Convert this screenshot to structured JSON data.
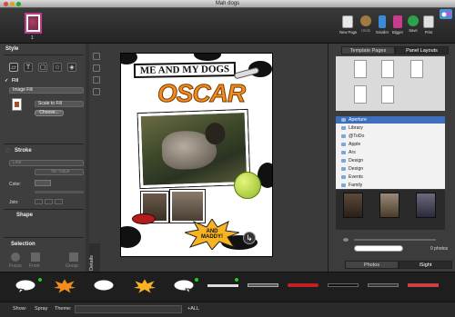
{
  "window": {
    "title": "Mah dogs",
    "traffic_colors": [
      "#e0443e",
      "#dea123",
      "#1aab29"
    ]
  },
  "toolbar": {
    "page_number": "1",
    "buttons": [
      {
        "label": "New Page",
        "color": "#e8e8e8"
      },
      {
        "label": "Undo",
        "color": "#a07a40"
      },
      {
        "label": "Smaller",
        "color": "#3b8ad9"
      },
      {
        "label": "Bigger",
        "color": "#c93b8c"
      },
      {
        "label": "Save",
        "color": "#2aa34a"
      },
      {
        "label": "Print",
        "color": "#e0e0e0"
      }
    ]
  },
  "style_panel": {
    "title": "Style",
    "fill_label": "Fill",
    "fill_type": "Image Fill",
    "scale_mode": "Scale to Fill",
    "choose_button": "Choose...",
    "stroke_label": "Stroke",
    "stroke_style": "Line",
    "stroke_value": "No Value",
    "color_label": "Color:",
    "join_label": "Join:",
    "shape_label": "Shape",
    "selection_label": "Selection",
    "selection_buttons": [
      "Focus",
      "Front",
      "Group"
    ]
  },
  "canvas": {
    "hide_details": "Hide Details",
    "heading_text": "ME AND MY DOGS",
    "name_text": "OSCAR",
    "burst_text": "AND MADDY!"
  },
  "right_panel": {
    "tabs": [
      "Template Pages",
      "Panel Layouts"
    ],
    "active_tab": 1,
    "source_tree": [
      {
        "label": "Aperture",
        "selected": true
      },
      {
        "label": "Library"
      },
      {
        "label": "@ToDo"
      },
      {
        "label": "Apple"
      },
      {
        "label": "Ars"
      },
      {
        "label": "Design"
      },
      {
        "label": "Design"
      },
      {
        "label": "Events"
      },
      {
        "label": "Family"
      }
    ],
    "photo_count": "0 photos",
    "bottom_tabs": [
      "Photos",
      "iSight"
    ],
    "active_bottom_tab": 1
  },
  "statusbar": {
    "show_label": "Show:",
    "spray_label": "Spray",
    "theme_label": "Theme:",
    "all_label": "+ALL"
  }
}
